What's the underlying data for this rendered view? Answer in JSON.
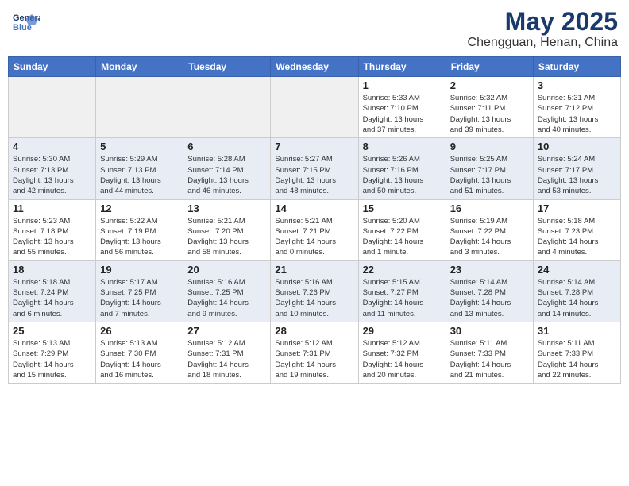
{
  "header": {
    "logo_line1": "General",
    "logo_line2": "Blue",
    "month": "May 2025",
    "location": "Chengguan, Henan, China"
  },
  "weekdays": [
    "Sunday",
    "Monday",
    "Tuesday",
    "Wednesday",
    "Thursday",
    "Friday",
    "Saturday"
  ],
  "weeks": [
    [
      {
        "day": "",
        "detail": ""
      },
      {
        "day": "",
        "detail": ""
      },
      {
        "day": "",
        "detail": ""
      },
      {
        "day": "",
        "detail": ""
      },
      {
        "day": "1",
        "detail": "Sunrise: 5:33 AM\nSunset: 7:10 PM\nDaylight: 13 hours\nand 37 minutes."
      },
      {
        "day": "2",
        "detail": "Sunrise: 5:32 AM\nSunset: 7:11 PM\nDaylight: 13 hours\nand 39 minutes."
      },
      {
        "day": "3",
        "detail": "Sunrise: 5:31 AM\nSunset: 7:12 PM\nDaylight: 13 hours\nand 40 minutes."
      }
    ],
    [
      {
        "day": "4",
        "detail": "Sunrise: 5:30 AM\nSunset: 7:13 PM\nDaylight: 13 hours\nand 42 minutes."
      },
      {
        "day": "5",
        "detail": "Sunrise: 5:29 AM\nSunset: 7:13 PM\nDaylight: 13 hours\nand 44 minutes."
      },
      {
        "day": "6",
        "detail": "Sunrise: 5:28 AM\nSunset: 7:14 PM\nDaylight: 13 hours\nand 46 minutes."
      },
      {
        "day": "7",
        "detail": "Sunrise: 5:27 AM\nSunset: 7:15 PM\nDaylight: 13 hours\nand 48 minutes."
      },
      {
        "day": "8",
        "detail": "Sunrise: 5:26 AM\nSunset: 7:16 PM\nDaylight: 13 hours\nand 50 minutes."
      },
      {
        "day": "9",
        "detail": "Sunrise: 5:25 AM\nSunset: 7:17 PM\nDaylight: 13 hours\nand 51 minutes."
      },
      {
        "day": "10",
        "detail": "Sunrise: 5:24 AM\nSunset: 7:17 PM\nDaylight: 13 hours\nand 53 minutes."
      }
    ],
    [
      {
        "day": "11",
        "detail": "Sunrise: 5:23 AM\nSunset: 7:18 PM\nDaylight: 13 hours\nand 55 minutes."
      },
      {
        "day": "12",
        "detail": "Sunrise: 5:22 AM\nSunset: 7:19 PM\nDaylight: 13 hours\nand 56 minutes."
      },
      {
        "day": "13",
        "detail": "Sunrise: 5:21 AM\nSunset: 7:20 PM\nDaylight: 13 hours\nand 58 minutes."
      },
      {
        "day": "14",
        "detail": "Sunrise: 5:21 AM\nSunset: 7:21 PM\nDaylight: 14 hours\nand 0 minutes."
      },
      {
        "day": "15",
        "detail": "Sunrise: 5:20 AM\nSunset: 7:22 PM\nDaylight: 14 hours\nand 1 minute."
      },
      {
        "day": "16",
        "detail": "Sunrise: 5:19 AM\nSunset: 7:22 PM\nDaylight: 14 hours\nand 3 minutes."
      },
      {
        "day": "17",
        "detail": "Sunrise: 5:18 AM\nSunset: 7:23 PM\nDaylight: 14 hours\nand 4 minutes."
      }
    ],
    [
      {
        "day": "18",
        "detail": "Sunrise: 5:18 AM\nSunset: 7:24 PM\nDaylight: 14 hours\nand 6 minutes."
      },
      {
        "day": "19",
        "detail": "Sunrise: 5:17 AM\nSunset: 7:25 PM\nDaylight: 14 hours\nand 7 minutes."
      },
      {
        "day": "20",
        "detail": "Sunrise: 5:16 AM\nSunset: 7:25 PM\nDaylight: 14 hours\nand 9 minutes."
      },
      {
        "day": "21",
        "detail": "Sunrise: 5:16 AM\nSunset: 7:26 PM\nDaylight: 14 hours\nand 10 minutes."
      },
      {
        "day": "22",
        "detail": "Sunrise: 5:15 AM\nSunset: 7:27 PM\nDaylight: 14 hours\nand 11 minutes."
      },
      {
        "day": "23",
        "detail": "Sunrise: 5:14 AM\nSunset: 7:28 PM\nDaylight: 14 hours\nand 13 minutes."
      },
      {
        "day": "24",
        "detail": "Sunrise: 5:14 AM\nSunset: 7:28 PM\nDaylight: 14 hours\nand 14 minutes."
      }
    ],
    [
      {
        "day": "25",
        "detail": "Sunrise: 5:13 AM\nSunset: 7:29 PM\nDaylight: 14 hours\nand 15 minutes."
      },
      {
        "day": "26",
        "detail": "Sunrise: 5:13 AM\nSunset: 7:30 PM\nDaylight: 14 hours\nand 16 minutes."
      },
      {
        "day": "27",
        "detail": "Sunrise: 5:12 AM\nSunset: 7:31 PM\nDaylight: 14 hours\nand 18 minutes."
      },
      {
        "day": "28",
        "detail": "Sunrise: 5:12 AM\nSunset: 7:31 PM\nDaylight: 14 hours\nand 19 minutes."
      },
      {
        "day": "29",
        "detail": "Sunrise: 5:12 AM\nSunset: 7:32 PM\nDaylight: 14 hours\nand 20 minutes."
      },
      {
        "day": "30",
        "detail": "Sunrise: 5:11 AM\nSunset: 7:33 PM\nDaylight: 14 hours\nand 21 minutes."
      },
      {
        "day": "31",
        "detail": "Sunrise: 5:11 AM\nSunset: 7:33 PM\nDaylight: 14 hours\nand 22 minutes."
      }
    ]
  ]
}
